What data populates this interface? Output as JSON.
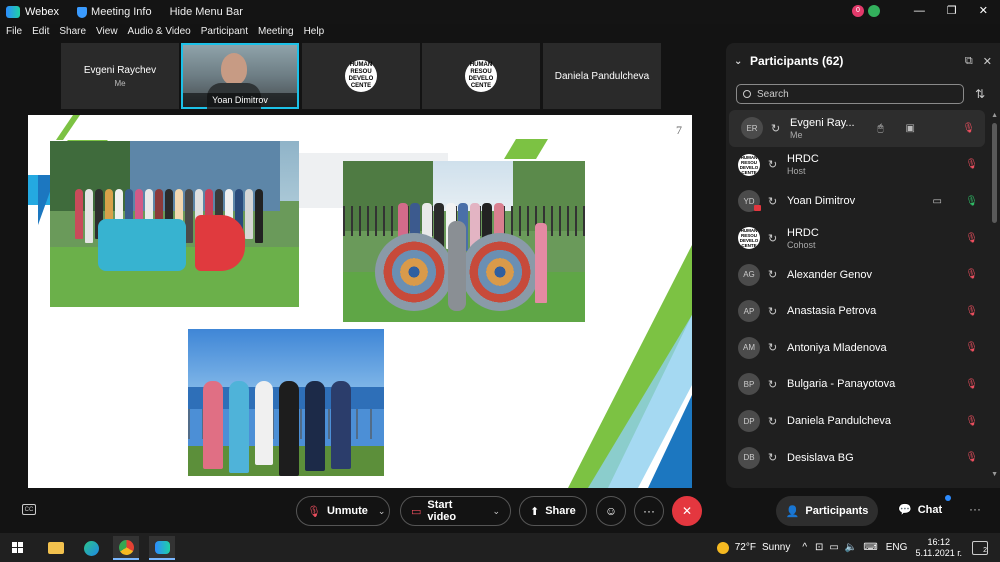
{
  "titlebar": {
    "app_name": "Webex",
    "meeting_info": "Meeting Info",
    "hide_menu": "Hide Menu Bar",
    "badge": "0"
  },
  "menu": [
    "File",
    "Edit",
    "Share",
    "View",
    "Audio & Video",
    "Participant",
    "Meeting",
    "Help"
  ],
  "video_strip": [
    {
      "name": "Evgeni Raychev",
      "sub": "Me",
      "type": "name"
    },
    {
      "name": "Yoan Dimitrov",
      "type": "video"
    },
    {
      "logo": "HUMAN RESOU DEVELO CENTE",
      "type": "logo"
    },
    {
      "logo": "HUMAN RESOU DEVELO CENTE",
      "type": "logo"
    },
    {
      "name": "Daniela Pandulcheva",
      "type": "name"
    }
  ],
  "slide": {
    "page_number": "7"
  },
  "participants_panel": {
    "title": "Participants (62)",
    "search_placeholder": "Search",
    "items": [
      {
        "initials": "ER",
        "name": "Evgeni Ray...",
        "role": "Me",
        "mic": "muted",
        "logo": false
      },
      {
        "initials": "",
        "name": "HRDC",
        "role": "Host",
        "mic": "muted",
        "logo": true,
        "logo_text": "HUMAN RESOU DEVELO CENTE"
      },
      {
        "initials": "YD",
        "name": "Yoan Dimitrov",
        "role": "",
        "mic": "on",
        "logo": false,
        "video": true
      },
      {
        "initials": "",
        "name": "HRDC",
        "role": "Cohost",
        "mic": "muted",
        "logo": true,
        "logo_text": "HUMAN RESOU DEVELO CENTE"
      },
      {
        "initials": "AG",
        "name": "Alexander Genov",
        "role": "",
        "mic": "muted",
        "logo": false
      },
      {
        "initials": "AP",
        "name": "Anastasia Petrova",
        "role": "",
        "mic": "muted",
        "logo": false
      },
      {
        "initials": "AM",
        "name": "Antoniya Mladenova",
        "role": "",
        "mic": "muted",
        "logo": false
      },
      {
        "initials": "BP",
        "name": "Bulgaria - Panayotova",
        "role": "",
        "mic": "muted",
        "logo": false
      },
      {
        "initials": "DP",
        "name": "Daniela Pandulcheva",
        "role": "",
        "mic": "muted",
        "logo": false
      },
      {
        "initials": "DB",
        "name": "Desislava BG",
        "role": "",
        "mic": "muted",
        "logo": false
      }
    ]
  },
  "controls": {
    "unmute": "Unmute",
    "start_video": "Start video",
    "share": "Share",
    "participants": "Participants",
    "chat": "Chat"
  },
  "taskbar": {
    "weather_temp": "72°F",
    "weather_desc": "Sunny",
    "language": "ENG",
    "time": "16:12",
    "date": "5.11.2021 г.",
    "notif_count": "2"
  },
  "colors": {
    "accent_blue": "#1cc1e8",
    "muted_red": "#ef4f5f",
    "mic_green": "#2fbf67",
    "end_call": "#e4373f"
  }
}
